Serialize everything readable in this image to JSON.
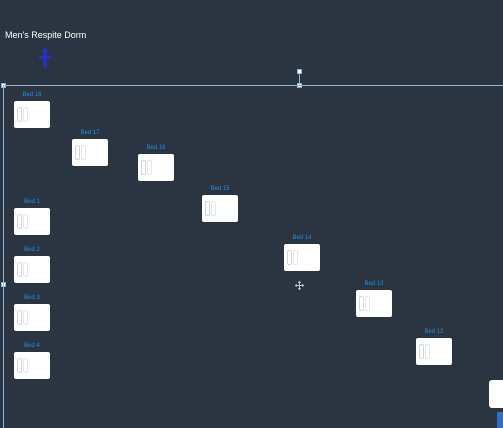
{
  "app": {
    "title": "Men's Respite Dorm"
  },
  "icons": {
    "person": "person-icon",
    "move": "move-icon",
    "pillow": "pillow-icon"
  },
  "colors": {
    "background": "#2b3541",
    "bed_label": "#1e8fe6",
    "bed_fill": "#ffffff",
    "selection_border": "#8fb3d9",
    "person_icon": "#2231c9"
  },
  "beds": [
    {
      "label": "Bed 18"
    },
    {
      "label": "Bed 17"
    },
    {
      "label": "Bed 16"
    },
    {
      "label": "Bed 15"
    },
    {
      "label": "Bed 14"
    },
    {
      "label": "Bed 13"
    },
    {
      "label": "Bed 12"
    },
    {
      "label": "Bed 1"
    },
    {
      "label": "Bed 2"
    },
    {
      "label": "Bed 3"
    },
    {
      "label": "Bed 4"
    }
  ]
}
